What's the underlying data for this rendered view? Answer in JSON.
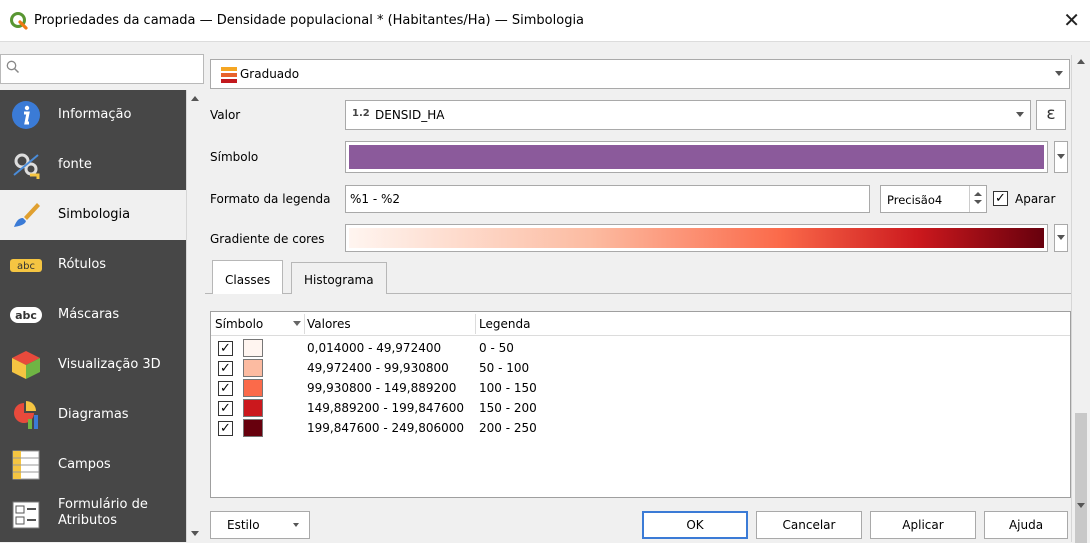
{
  "window": {
    "title": "Propriedades da camada — Densidade populacional * (Habitantes/Ha) — Simbologia",
    "close_glyph": "✕"
  },
  "search": {
    "placeholder": ""
  },
  "sidebar": {
    "items": [
      {
        "label": "Informação",
        "icon": "info-icon"
      },
      {
        "label": "fonte",
        "icon": "source-icon"
      },
      {
        "label": "Simbologia",
        "icon": "paintbrush-icon"
      },
      {
        "label": "Rótulos",
        "icon": "abc-label-icon"
      },
      {
        "label": "Máscaras",
        "icon": "abc-mask-icon"
      },
      {
        "label": "Visualização 3D",
        "icon": "cube-3d-icon"
      },
      {
        "label": "Diagramas",
        "icon": "diagram-icon"
      },
      {
        "label": "Campos",
        "icon": "fields-icon"
      },
      {
        "label": "Formulário de Atributos",
        "label_line1": "Formulário de",
        "label_line2": "Atributos",
        "icon": "form-icon"
      }
    ],
    "active_index": 2
  },
  "renderer": {
    "selected": "Graduado"
  },
  "form": {
    "value_label": "Valor",
    "value_type_badge": "1.2",
    "value_field": "DENSID_HA",
    "expression_glyph": "ε",
    "symbol_label": "Símbolo",
    "symbol_color": "#8b5a9b",
    "legend_format_label": "Formato da legenda",
    "legend_format_value": "%1 - %2",
    "precision_label": "Precisão",
    "precision_value": "4",
    "trim_label": "Aparar",
    "trim_checked": true,
    "color_ramp_label": "Gradiente de cores"
  },
  "tabs": [
    {
      "label": "Classes",
      "active": true
    },
    {
      "label": "Histograma",
      "active": false
    }
  ],
  "classes_table": {
    "headers": {
      "symbol": "Símbolo",
      "values": "Valores",
      "legend": "Legenda"
    },
    "rows": [
      {
        "checked": true,
        "color": "#fff5f0",
        "values": "0,014000 - 49,972400",
        "legend": "0 - 50"
      },
      {
        "checked": true,
        "color": "#fcbba1",
        "values": "49,972400 - 99,930800",
        "legend": "50 - 100"
      },
      {
        "checked": true,
        "color": "#fb6a4a",
        "values": "99,930800 - 149,889200",
        "legend": "100 - 150"
      },
      {
        "checked": true,
        "color": "#cb181d",
        "values": "149,889200 - 199,847600",
        "legend": "150 - 200"
      },
      {
        "checked": true,
        "color": "#67000d",
        "values": "199,847600 - 249,806000",
        "legend": "200 - 250"
      }
    ]
  },
  "buttons": {
    "style": "Estilo",
    "ok": "OK",
    "cancel": "Cancelar",
    "apply": "Aplicar",
    "help": "Ajuda"
  },
  "check_glyph": "✓"
}
